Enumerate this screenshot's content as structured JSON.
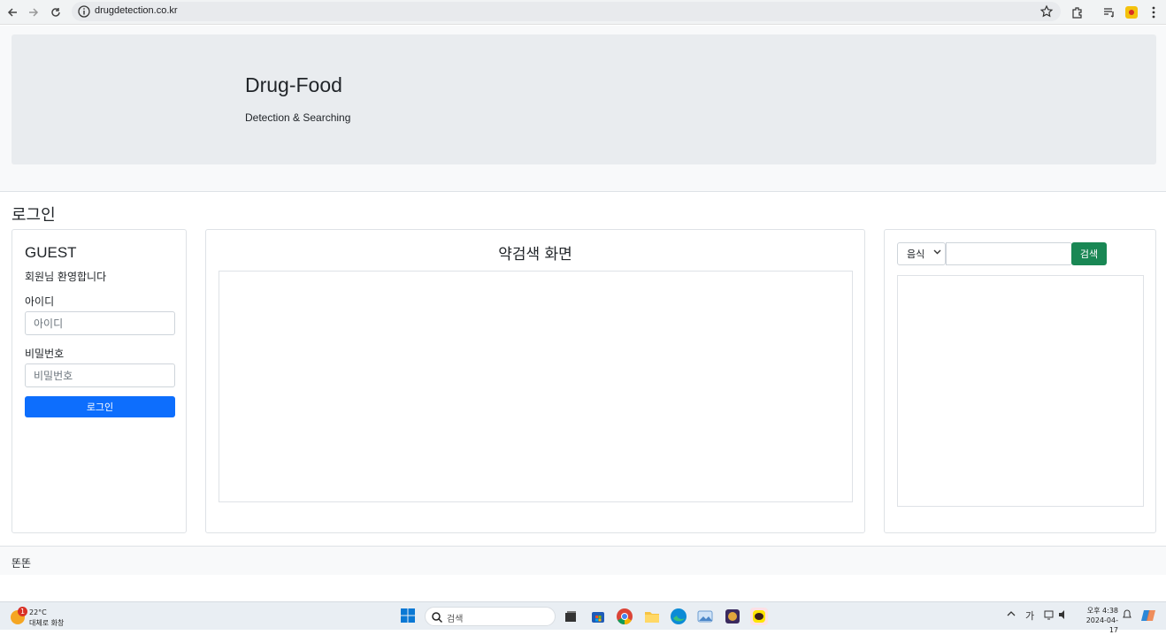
{
  "browser": {
    "url": "drugdetection.co.kr"
  },
  "header": {
    "title": "Drug-Food",
    "subtitle": "Detection & Searching"
  },
  "section_title": "로그인",
  "login": {
    "user": "GUEST",
    "welcome": "회원님 환영합니다",
    "id_label": "아이디",
    "id_placeholder": "아이디",
    "pw_label": "비밀번호",
    "pw_placeholder": "비밀번호",
    "button": "로그인"
  },
  "center": {
    "title": "약검색 화면"
  },
  "search": {
    "select_value": "음식",
    "button": "검색"
  },
  "footer": {
    "text": "똔똔"
  },
  "taskbar": {
    "weather_badge": "1",
    "temperature": "22°C",
    "weather_desc": "대체로 화창",
    "search_label": "검색",
    "ime": "가",
    "time": "오후 4:38",
    "date": "2024-04-17"
  },
  "colors": {
    "primary": "#0d6efd",
    "success": "#198754",
    "jumbotron": "#e9ecef"
  }
}
